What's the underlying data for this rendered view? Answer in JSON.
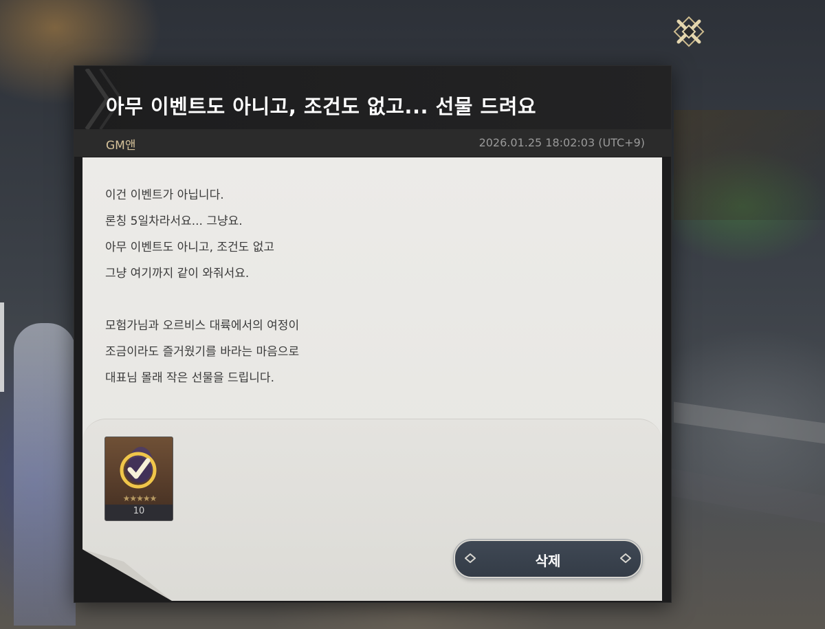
{
  "mail": {
    "title": "아무 이벤트도 아니고, 조건도 없고... 선물 드려요",
    "sender": "GM앤",
    "timestamp": "2026.01.25 18:02:03 (UTC+9)",
    "body_lines": [
      "이건 이벤트가 아닙니다.",
      "론칭 5일차라서요... 그냥요.",
      "아무 이벤트도 아니고, 조건도 없고",
      "그냥 여기까지 같이 와줘서요.",
      "",
      "모험가님과 오르비스 대륙에서의 여정이",
      "조금이라도 즐거웠기를 바라는 마음으로",
      "대표님 몰래 작은 선물을 드립니다."
    ]
  },
  "attachment": {
    "icon": "checkmark-ticket-icon",
    "stars": "★★★★★",
    "count": "10"
  },
  "actions": {
    "delete_label": "삭제",
    "close_icon": "close-x-icon"
  },
  "colors": {
    "header_bg": "#1d1d1e",
    "sender": "#d6c29a",
    "paper": "#ecebe8",
    "button_bg": "#3f4854"
  }
}
